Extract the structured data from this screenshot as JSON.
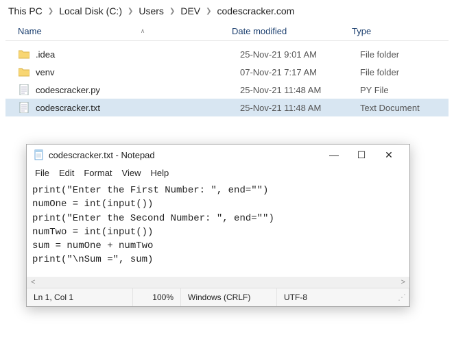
{
  "breadcrumb": [
    "This PC",
    "Local Disk (C:)",
    "Users",
    "DEV",
    "codescracker.com"
  ],
  "columns": {
    "name": "Name",
    "date": "Date modified",
    "type": "Type"
  },
  "rows": [
    {
      "icon": "folder",
      "name": ".idea",
      "date": "25-Nov-21 9:01 AM",
      "type": "File folder",
      "selected": false
    },
    {
      "icon": "folder",
      "name": "venv",
      "date": "07-Nov-21 7:17 AM",
      "type": "File folder",
      "selected": false
    },
    {
      "icon": "text",
      "name": "codescracker.py",
      "date": "25-Nov-21 11:48 AM",
      "type": "PY File",
      "selected": false
    },
    {
      "icon": "text",
      "name": "codescracker.txt",
      "date": "25-Nov-21 11:48 AM",
      "type": "Text Document",
      "selected": true
    }
  ],
  "notepad": {
    "title": "codescracker.txt - Notepad",
    "menu": [
      "File",
      "Edit",
      "Format",
      "View",
      "Help"
    ],
    "content": "print(\"Enter the First Number: \", end=\"\")\nnumOne = int(input())\nprint(\"Enter the Second Number: \", end=\"\")\nnumTwo = int(input())\nsum = numOne + numTwo\nprint(\"\\nSum =\", sum)",
    "status": {
      "pos": "Ln 1, Col 1",
      "zoom": "100%",
      "eol": "Windows (CRLF)",
      "enc": "UTF-8"
    },
    "scroll": {
      "left": "<",
      "right": ">"
    },
    "winbtn": {
      "min": "—",
      "max": "☐",
      "close": "✕"
    }
  }
}
